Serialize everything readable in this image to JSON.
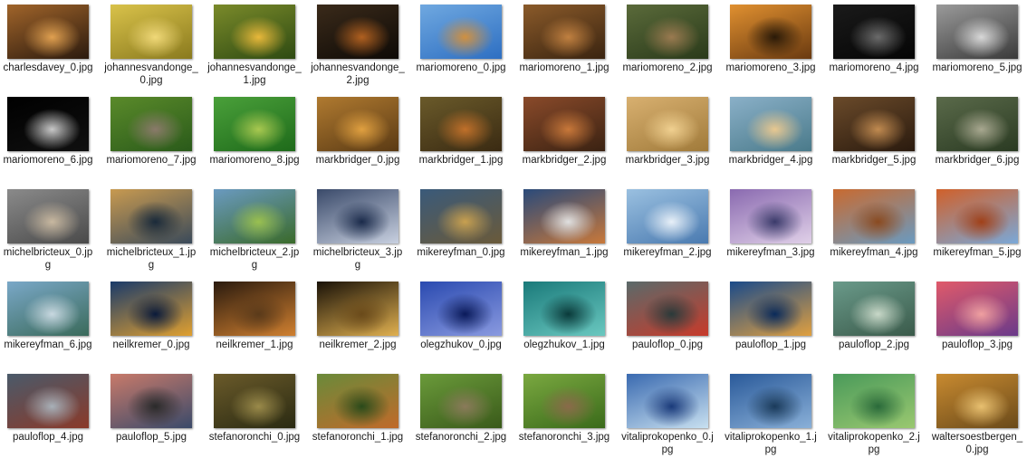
{
  "files": [
    {
      "name": "charlesdavey_0.jpg",
      "colors": [
        "#a0642a",
        "#2b1a0e",
        "#e0a050"
      ]
    },
    {
      "name": "johannesvandonge_0.jpg",
      "colors": [
        "#d9c24a",
        "#8a7a1e",
        "#f0d878"
      ]
    },
    {
      "name": "johannesvandonge_1.jpg",
      "colors": [
        "#7a8a2a",
        "#2e4a12",
        "#e8b83a"
      ]
    },
    {
      "name": "johannesvandonge_2.jpg",
      "colors": [
        "#3a2a1a",
        "#0e0a06",
        "#b06020"
      ]
    },
    {
      "name": "mariomoreno_0.jpg",
      "colors": [
        "#6fa8e0",
        "#2e6fc2",
        "#d09040"
      ]
    },
    {
      "name": "mariomoreno_1.jpg",
      "colors": [
        "#8a5a2a",
        "#3a2410",
        "#c08040"
      ]
    },
    {
      "name": "mariomoreno_2.jpg",
      "colors": [
        "#5a6a3a",
        "#2a3a1a",
        "#9a7a50"
      ]
    },
    {
      "name": "mariomoreno_3.jpg",
      "colors": [
        "#e09030",
        "#6a3a10",
        "#2a1a08"
      ]
    },
    {
      "name": "mariomoreno_4.jpg",
      "colors": [
        "#1a1a1a",
        "#050505",
        "#6a6a6a"
      ]
    },
    {
      "name": "mariomoreno_5.jpg",
      "colors": [
        "#9a9a9a",
        "#3a3a3a",
        "#d8d8d8"
      ]
    },
    {
      "name": "mariomoreno_6.jpg",
      "colors": [
        "#000000",
        "#101010",
        "#c8c8c8"
      ]
    },
    {
      "name": "mariomoreno_7.jpg",
      "colors": [
        "#5a8a2a",
        "#2a5a1a",
        "#8a7a6a"
      ]
    },
    {
      "name": "mariomoreno_8.jpg",
      "colors": [
        "#4aa03a",
        "#1e6a1a",
        "#a8c850"
      ]
    },
    {
      "name": "markbridger_0.jpg",
      "colors": [
        "#b07a30",
        "#5a3a14",
        "#e0a040"
      ]
    },
    {
      "name": "markbridger_1.jpg",
      "colors": [
        "#6a5a2a",
        "#3a2a12",
        "#c0702a"
      ]
    },
    {
      "name": "markbridger_2.jpg",
      "colors": [
        "#8a4a2a",
        "#3a2212",
        "#c8783a"
      ]
    },
    {
      "name": "markbridger_3.jpg",
      "colors": [
        "#d8b070",
        "#a07a3a",
        "#f0d090"
      ]
    },
    {
      "name": "markbridger_4.jpg",
      "colors": [
        "#8ab0c8",
        "#4a7a8a",
        "#e8c890"
      ]
    },
    {
      "name": "markbridger_5.jpg",
      "colors": [
        "#6a4a2a",
        "#2a1a0e",
        "#c08a50"
      ]
    },
    {
      "name": "markbridger_6.jpg",
      "colors": [
        "#5a6a4a",
        "#2a3a22",
        "#a8a890"
      ]
    },
    {
      "name": "michelbricteux_0.jpg",
      "colors": [
        "#8a8a8a",
        "#4a4a4a",
        "#c8b8a0"
      ]
    },
    {
      "name": "michelbricteux_1.jpg",
      "colors": [
        "#c89a50",
        "#3a4a5a",
        "#1a2a3a"
      ]
    },
    {
      "name": "michelbricteux_2.jpg",
      "colors": [
        "#6a9ac0",
        "#3a6a2a",
        "#9ac050"
      ]
    },
    {
      "name": "michelbricteux_3.jpg",
      "colors": [
        "#3a4a6a",
        "#c8d0e0",
        "#1a2a4a"
      ]
    },
    {
      "name": "mikereyfman_0.jpg",
      "colors": [
        "#3a5a7a",
        "#6a5a3a",
        "#c8a050"
      ]
    },
    {
      "name": "mikereyfman_1.jpg",
      "colors": [
        "#2a4a7a",
        "#c8783a",
        "#e0e0e0"
      ]
    },
    {
      "name": "mikereyfman_2.jpg",
      "colors": [
        "#9ac0e0",
        "#4a7ab0",
        "#e8f0f8"
      ]
    },
    {
      "name": "mikereyfman_3.jpg",
      "colors": [
        "#8a6ab0",
        "#e0d0e8",
        "#3a3a6a"
      ]
    },
    {
      "name": "mikereyfman_4.jpg",
      "colors": [
        "#c86a30",
        "#6a9ac0",
        "#8a4a20"
      ]
    },
    {
      "name": "mikereyfman_5.jpg",
      "colors": [
        "#d0602a",
        "#7aa8d8",
        "#a04018"
      ]
    },
    {
      "name": "mikereyfman_6.jpg",
      "colors": [
        "#7aa8c8",
        "#3a6a5a",
        "#c8d8e0"
      ]
    },
    {
      "name": "neilkremer_0.jpg",
      "colors": [
        "#1a3a6a",
        "#e0a030",
        "#0a1a3a"
      ]
    },
    {
      "name": "neilkremer_1.jpg",
      "colors": [
        "#2a1a0e",
        "#d08030",
        "#5a3a1a"
      ]
    },
    {
      "name": "neilkremer_2.jpg",
      "colors": [
        "#1a1208",
        "#e0b050",
        "#6a4a1a"
      ]
    },
    {
      "name": "olegzhukov_0.jpg",
      "colors": [
        "#2a4ab0",
        "#8a9ae0",
        "#0a1a5a"
      ]
    },
    {
      "name": "olegzhukov_1.jpg",
      "colors": [
        "#1a7a7a",
        "#6ac8c0",
        "#0a3a3a"
      ]
    },
    {
      "name": "pauloflop_0.jpg",
      "colors": [
        "#5a6a6a",
        "#c83a2a",
        "#2a3a3a"
      ]
    },
    {
      "name": "pauloflop_1.jpg",
      "colors": [
        "#1a4a8a",
        "#e0a040",
        "#0a2a5a"
      ]
    },
    {
      "name": "pauloflop_2.jpg",
      "colors": [
        "#6a9a8a",
        "#3a5a4a",
        "#c8d8c8"
      ]
    },
    {
      "name": "pauloflop_3.jpg",
      "colors": [
        "#e05a6a",
        "#6a3a8a",
        "#f0a0a0"
      ]
    },
    {
      "name": "pauloflop_4.jpg",
      "colors": [
        "#4a5a6a",
        "#8a3a2a",
        "#a8b0b8"
      ]
    },
    {
      "name": "pauloflop_5.jpg",
      "colors": [
        "#c87a6a",
        "#3a4a6a",
        "#2a2a2a"
      ]
    },
    {
      "name": "stefanoronchi_0.jpg",
      "colors": [
        "#6a5a2a",
        "#2a2a12",
        "#9a8a4a"
      ]
    },
    {
      "name": "stefanoronchi_1.jpg",
      "colors": [
        "#6a8a3a",
        "#c06a2a",
        "#2a4a1a"
      ]
    },
    {
      "name": "stefanoronchi_2.jpg",
      "colors": [
        "#6a9a3a",
        "#3a5a1a",
        "#8a7a5a"
      ]
    },
    {
      "name": "stefanoronchi_3.jpg",
      "colors": [
        "#7aa840",
        "#3a6a1a",
        "#8a6a4a"
      ]
    },
    {
      "name": "vitaliprokopenko_0.jpg",
      "colors": [
        "#3a6ab0",
        "#c8e0f0",
        "#1a3a7a"
      ]
    },
    {
      "name": "vitaliprokopenko_1.jpg",
      "colors": [
        "#2a5a9a",
        "#8ab0d8",
        "#1a3a5a"
      ]
    },
    {
      "name": "vitaliprokopenko_2.jpg",
      "colors": [
        "#4a9a5a",
        "#9ac870",
        "#2a6a3a"
      ]
    },
    {
      "name": "waltersoestbergen_0.jpg",
      "colors": [
        "#c88a30",
        "#6a4a1a",
        "#e8c070"
      ]
    }
  ]
}
